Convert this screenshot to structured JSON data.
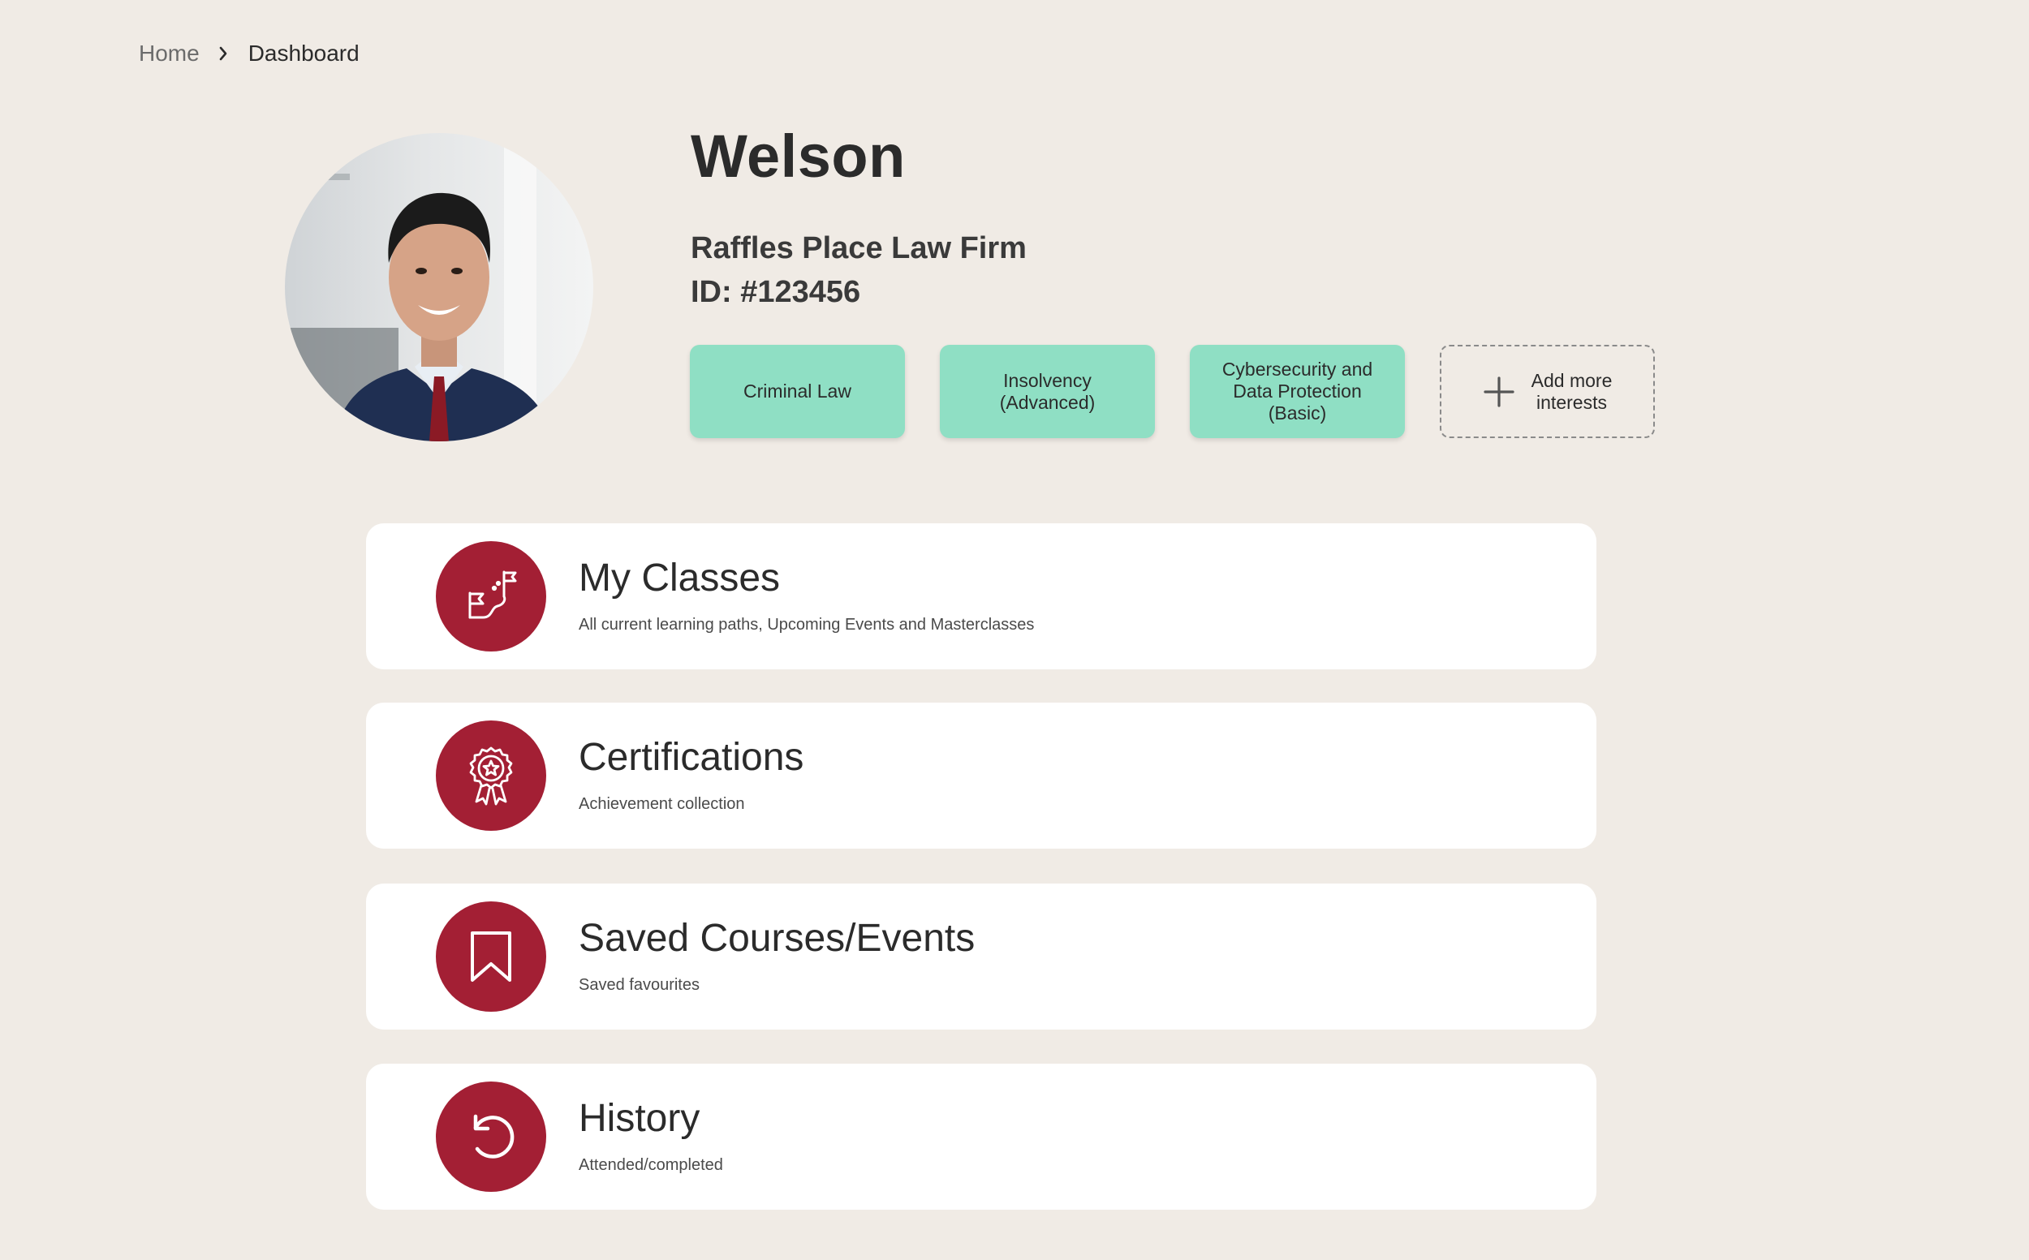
{
  "breadcrumb": {
    "home": "Home",
    "current": "Dashboard"
  },
  "profile": {
    "name": "Welson",
    "firm": "Raffles Place Law Firm",
    "id_label": "ID: #123456",
    "avatar_icon": "user-photo"
  },
  "interests": {
    "items": [
      {
        "label": "Criminal Law"
      },
      {
        "label": "Insolvency\n(Advanced)"
      },
      {
        "label": "Cybersecurity and\nData Protection\n(Basic)"
      }
    ],
    "add_label": "Add more\ninterests",
    "add_icon": "plus-icon"
  },
  "cards": [
    {
      "title": "My Classes",
      "description": "All current learning paths, Upcoming Events and Masterclasses",
      "icon": "path-flags-icon"
    },
    {
      "title": "Certifications",
      "description": "Achievement collection",
      "icon": "award-ribbon-icon"
    },
    {
      "title": "Saved Courses/Events",
      "description": "Saved favourites",
      "icon": "bookmark-icon"
    },
    {
      "title": "History",
      "description": "Attended/completed",
      "icon": "history-icon"
    }
  ],
  "colors": {
    "background": "#f0ebe5",
    "chip": "#8fdfc4",
    "accent": "#a31f34",
    "card": "#ffffff",
    "text": "#2b2b2b"
  }
}
